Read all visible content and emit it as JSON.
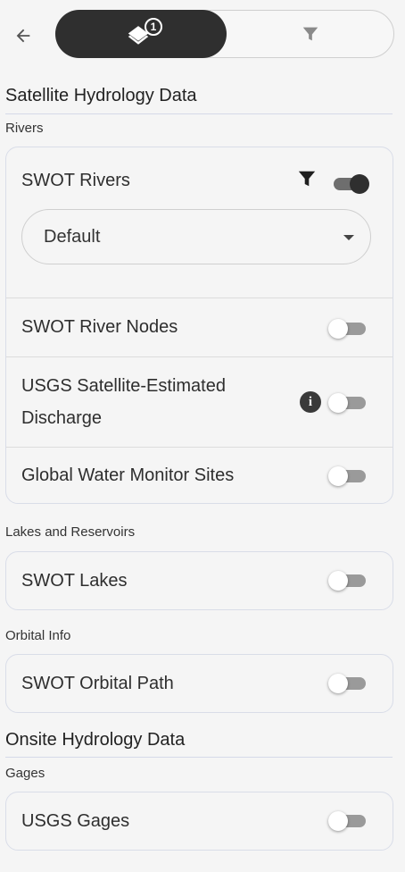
{
  "header": {
    "back_icon": "arrow-left-icon",
    "layers_tab_icon": "layers-icon",
    "layers_badge": "1",
    "filter_tab_icon": "filter-icon"
  },
  "sections": {
    "satellite": {
      "title": "Satellite Hydrology Data",
      "groups": {
        "rivers": {
          "label": "Rivers",
          "items": [
            {
              "label": "SWOT Rivers",
              "enabled": true,
              "has_filter": true,
              "select_value": "Default"
            },
            {
              "label": "SWOT River Nodes",
              "enabled": false
            },
            {
              "label": "USGS Satellite-Estimated Discharge",
              "enabled": false,
              "has_info": true
            },
            {
              "label": "Global Water Monitor Sites",
              "enabled": false
            }
          ]
        },
        "lakes": {
          "label": "Lakes and Reservoirs",
          "items": [
            {
              "label": "SWOT Lakes",
              "enabled": false
            }
          ]
        },
        "orbital": {
          "label": "Orbital Info",
          "items": [
            {
              "label": "SWOT Orbital Path",
              "enabled": false
            }
          ]
        }
      }
    },
    "onsite": {
      "title": "Onsite Hydrology Data",
      "groups": {
        "gages": {
          "label": "Gages",
          "items": [
            {
              "label": "USGS Gages",
              "enabled": false
            }
          ]
        }
      }
    }
  },
  "colors": {
    "accent_dark": "#2f2f2f",
    "background": "#f5f5f5",
    "card_border": "#d9dde8"
  }
}
